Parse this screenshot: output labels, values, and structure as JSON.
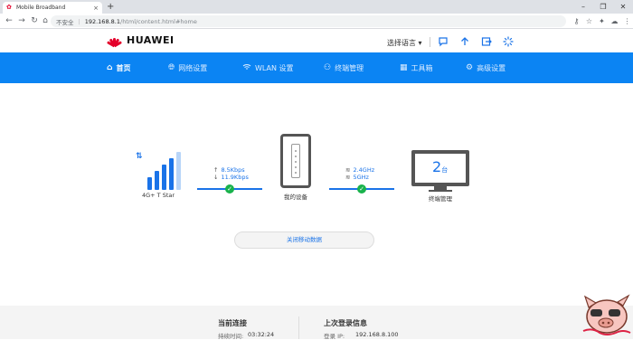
{
  "browser": {
    "tab_title": "Mobile Broadband",
    "tab_close": "×",
    "new_tab": "+",
    "url_secure_label": "不安全",
    "url_host": "192.168.8.1",
    "url_path": "/html/content.html#home"
  },
  "header": {
    "brand": "HUAWEI",
    "language_select": "选择语言 ▾"
  },
  "nav": {
    "items": [
      {
        "label": "首页",
        "icon": "home-icon"
      },
      {
        "label": "网络设置",
        "icon": "globe-icon"
      },
      {
        "label": "WLAN 设置",
        "icon": "wifi-icon"
      },
      {
        "label": "终端管理",
        "icon": "devices-icon"
      },
      {
        "label": "工具箱",
        "icon": "toolbox-icon"
      },
      {
        "label": "高级设置",
        "icon": "gear-icon"
      }
    ]
  },
  "status": {
    "network_label": "4G+ T Star",
    "upload_rate": "8.5Kbps",
    "download_rate": "11.9Kbps",
    "router_label": "我的设备",
    "wifi_band_1": "2.4GHz",
    "wifi_band_2": "5GHz",
    "device_count": "2",
    "device_unit": "台",
    "device_label": "终端管理",
    "close_mobile_data": "关闭移动数据"
  },
  "footer": {
    "current_title": "当前连接",
    "duration_label": "持续时间:",
    "duration_value": "03:32:24",
    "last_login_title": "上次登录信息",
    "login_ip_label": "登录 IP:",
    "login_ip_value": "192.168.8.100"
  },
  "colors": {
    "nav_blue": "#0b84f3",
    "accent_blue": "#1a73e8",
    "ok_green": "#19b24b",
    "brand_red": "#e4002b"
  }
}
